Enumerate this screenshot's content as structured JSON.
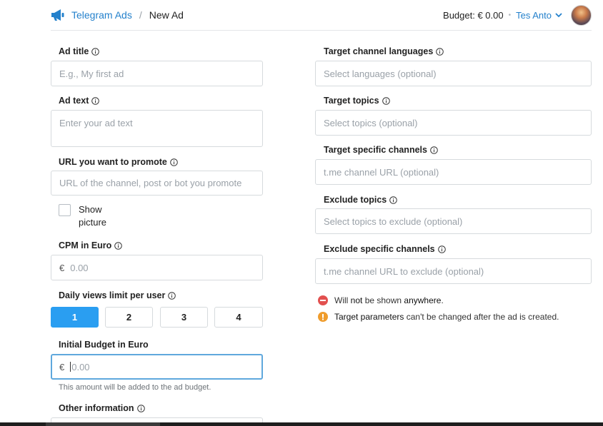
{
  "header": {
    "app_title": "Telegram Ads",
    "separator": "/",
    "breadcrumb": "New Ad",
    "budget": "Budget: € 0.00",
    "account_name": "Tes Anto"
  },
  "form_left": {
    "ad_title": {
      "label": "Ad title",
      "placeholder": "E.g., My first ad"
    },
    "ad_text": {
      "label": "Ad text",
      "placeholder": "Enter your ad text"
    },
    "url": {
      "label": "URL you want to promote",
      "placeholder": "URL of the channel, post or bot you promote"
    },
    "show_picture": {
      "label": "Show picture",
      "checked": false
    },
    "cpm": {
      "label": "CPM in Euro",
      "currency": "€",
      "placeholder": "0.00"
    },
    "daily_views": {
      "label": "Daily views limit per user",
      "options": [
        "1",
        "2",
        "3",
        "4"
      ],
      "selected": "1"
    },
    "initial_budget": {
      "label": "Initial Budget in Euro",
      "currency": "€",
      "placeholder": "0.00",
      "hint": "This amount will be added to the ad budget."
    },
    "other_info": {
      "label": "Other information"
    }
  },
  "form_right": {
    "languages": {
      "label": "Target channel languages",
      "placeholder": "Select languages (optional)"
    },
    "topics": {
      "label": "Target topics",
      "placeholder": "Select topics (optional)"
    },
    "channels": {
      "label": "Target specific channels",
      "placeholder": "t.me channel URL (optional)"
    },
    "exclude_topics": {
      "label": "Exclude topics",
      "placeholder": "Select topics to exclude (optional)"
    },
    "exclude_channels": {
      "label": "Exclude specific channels",
      "placeholder": "t.me channel URL to exclude (optional)"
    }
  },
  "notes": {
    "warning_prefix": "Will ",
    "warning_strong": "not",
    "warning_mid": " be shown ",
    "warning_end": "anywhere",
    "warning_dot": ".",
    "info_strong": "Target parameters",
    "info_rest": " can't be changed after the ad is created."
  },
  "colors": {
    "accent": "#2481cc",
    "selected_button": "#2a9ef1",
    "warning_red": "#e2504f",
    "info_orange": "#ef9c2c"
  },
  "icons": [
    "megaphone-icon",
    "chevron-down-icon",
    "info-icon",
    "stop-icon",
    "exclamation-icon"
  ]
}
